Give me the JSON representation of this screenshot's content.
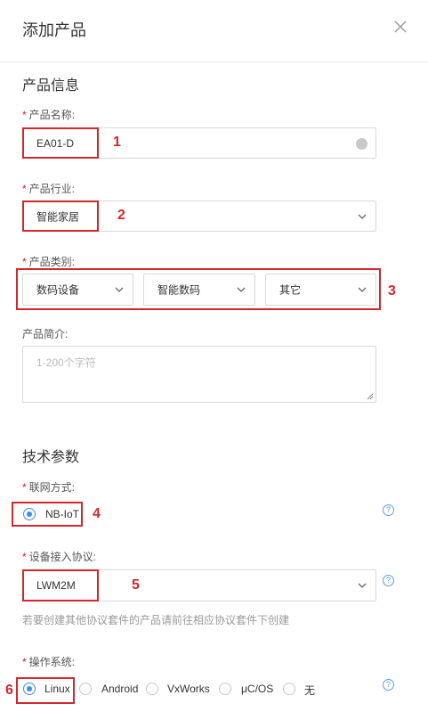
{
  "dialog": {
    "title": "添加产品"
  },
  "product_info": {
    "section_title": "产品信息",
    "name_label": "产品名称:",
    "name_value": "EA01-D",
    "industry_label": "产品行业:",
    "industry_value": "智能家居",
    "category_label": "产品类别:",
    "category_values": [
      "数码设备",
      "智能数码",
      "其它"
    ],
    "desc_label": "产品简介:",
    "desc_placeholder": "1-200个字符"
  },
  "tech_params": {
    "section_title": "技术参数",
    "network_label": "联网方式:",
    "network_options": [
      "NB-IoT"
    ],
    "network_selected": "NB-IoT",
    "protocol_label": "设备接入协议:",
    "protocol_value": "LWM2M",
    "protocol_hint": "若要创建其他协议套件的产品请前往相应协议套件下创建",
    "os_label": "操作系统:",
    "os_options": [
      "Linux",
      "Android",
      "VxWorks",
      "μC/OS",
      "无"
    ],
    "os_selected": "Linux"
  },
  "annotations": [
    "1",
    "2",
    "3",
    "4",
    "5",
    "6"
  ],
  "required_mark": "*",
  "help_glyph": "?",
  "colors": {
    "annotation": "#d4262b",
    "accent": "#3a8ee6",
    "required": "#e02020"
  },
  "icons": {
    "close": "close-icon",
    "chevron": "chevron-down-icon",
    "clear": "clear-icon",
    "help": "help-icon",
    "resize": "resize-handle-icon"
  }
}
